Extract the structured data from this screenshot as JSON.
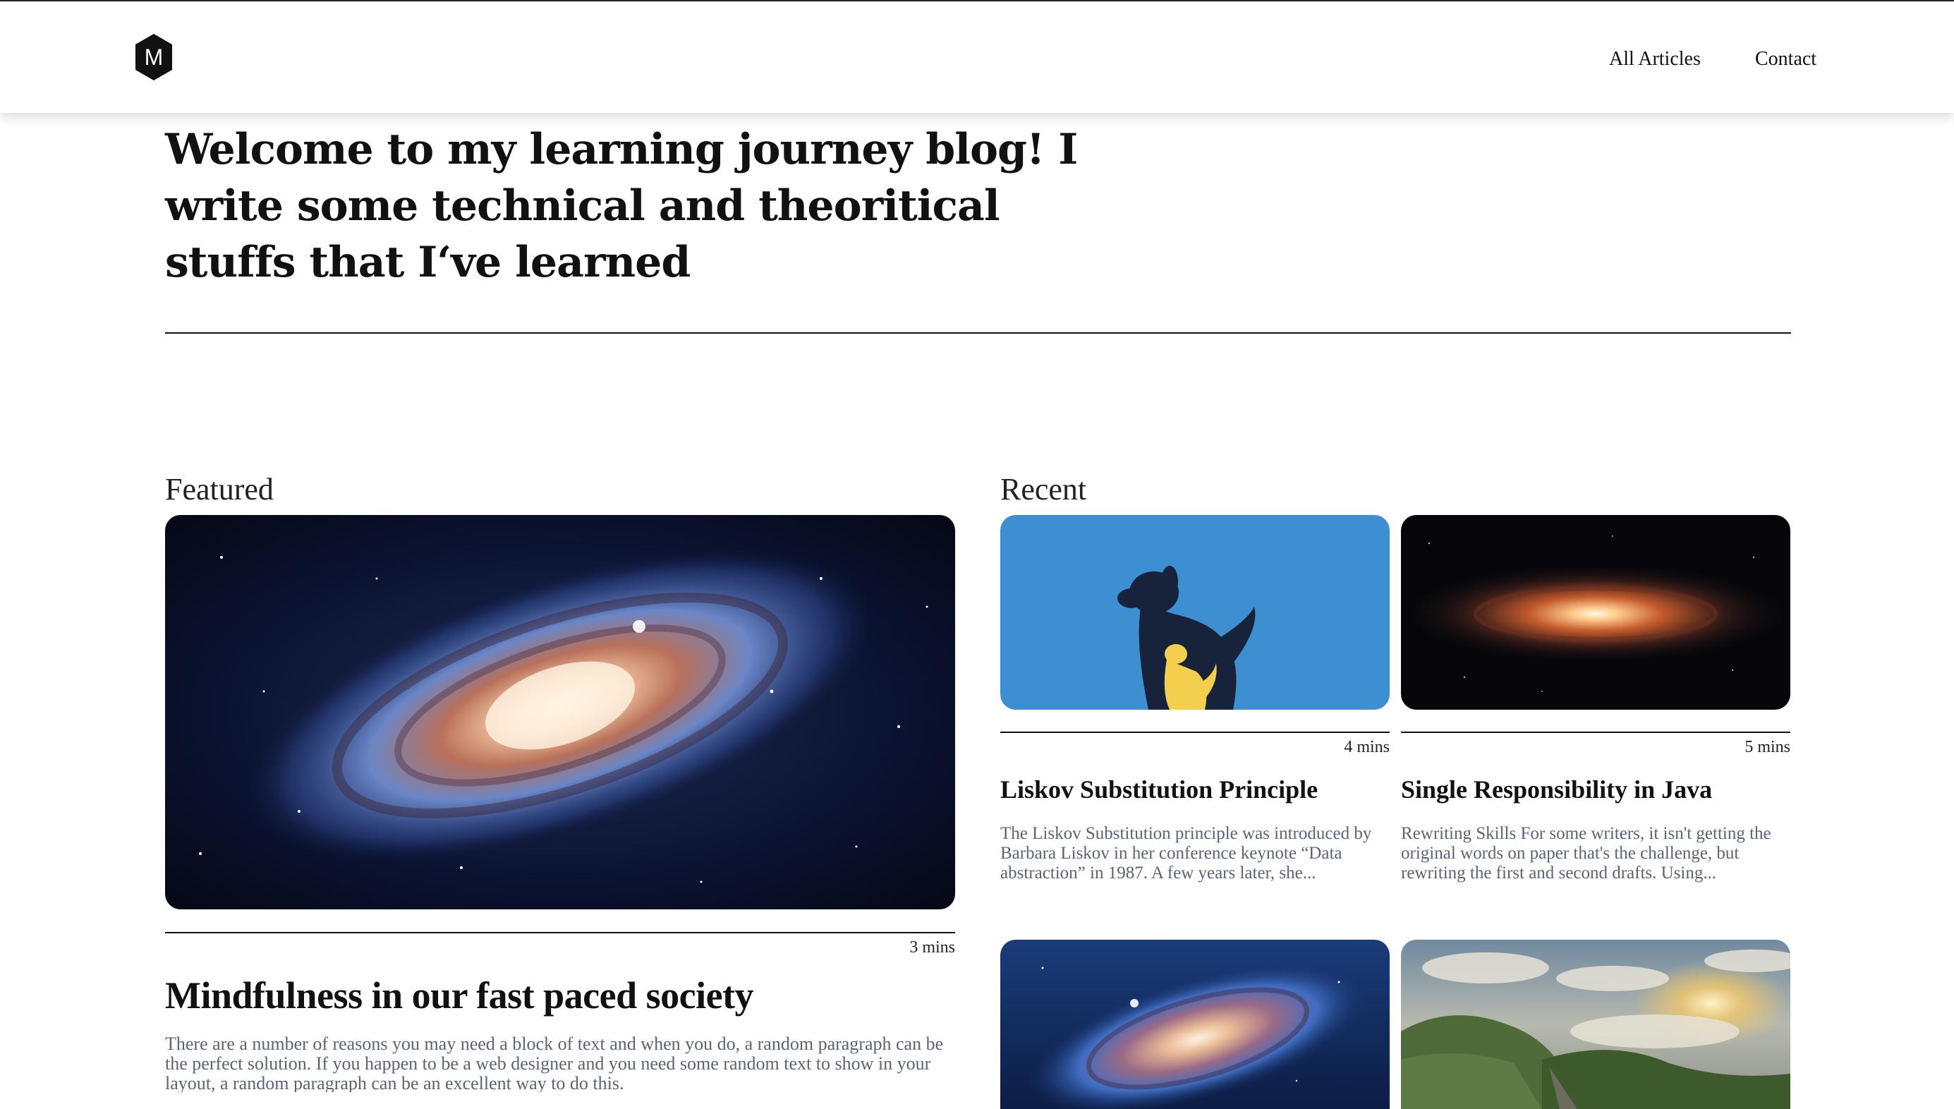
{
  "nav": {
    "logo_letter": "M",
    "links": [
      {
        "label": "All Articles"
      },
      {
        "label": "Contact"
      }
    ]
  },
  "hero": {
    "title": "Welcome to my learning journey blog! I write some technical and theoritical stuffs that I‘ve learned"
  },
  "featured": {
    "section_title": "Featured",
    "article": {
      "image": "galaxy-image",
      "read_time": "3 mins",
      "title": "Mindfulness in our fast paced society",
      "excerpt": "There are a number of reasons you may need a block of text and when you do, a random paragraph can be the perfect solution. If you happen to be a web designer and you need some random text to show in your layout, a random paragraph can be an excellent way to do this."
    }
  },
  "recent": {
    "section_title": "Recent",
    "articles": [
      {
        "image": "dog-cat-silhouette-image",
        "read_time": "4 mins",
        "title": "Liskov Substitution Principle",
        "excerpt": "The Liskov Substitution principle was introduced by Barbara Liskov in her conference keynote “Data abstraction” in 1987. A few years later, she..."
      },
      {
        "image": "dark-galaxy-image",
        "read_time": "5 mins",
        "title": "Single Responsibility in Java",
        "excerpt": "Rewriting Skills For some writers, it isn't getting the original words on paper that's the challenge, but rewriting the first and second drafts. Using..."
      },
      {
        "image": "blue-galaxy-image"
      },
      {
        "image": "mountain-landscape-image"
      }
    ]
  },
  "colors": {
    "text": "#111111",
    "excerpt": "#5a6477",
    "dog_card_bg": "#3d8fd1",
    "cat_yellow": "#f3cf4d"
  }
}
